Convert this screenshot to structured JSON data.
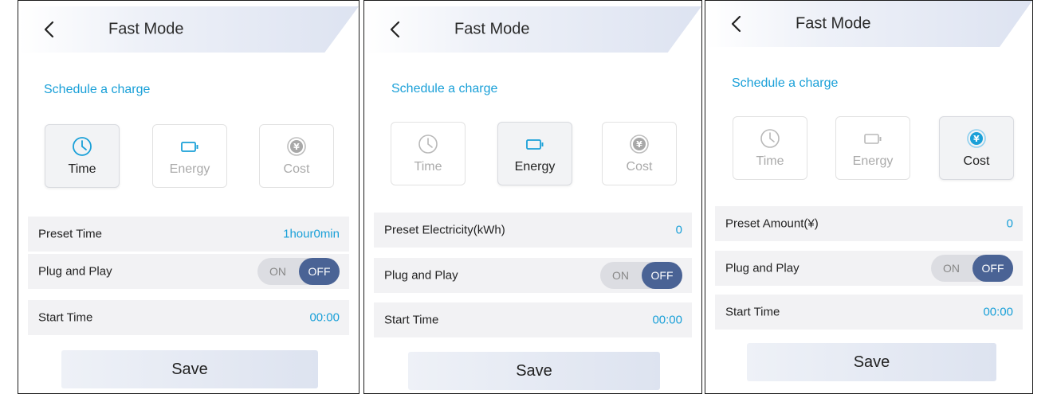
{
  "colors": {
    "accent": "#1aa0d8",
    "toggle_off_bg": "#4a6395",
    "icon_inactive": "#b8b8b8"
  },
  "screens": [
    {
      "header": {
        "back_icon": "chevron-left-icon",
        "title": "Fast Mode"
      },
      "section_title": "Schedule a charge",
      "modes": [
        {
          "label": "Time",
          "icon": "clock-icon",
          "active": true
        },
        {
          "label": "Energy",
          "icon": "battery-icon",
          "active": false
        },
        {
          "label": "Cost",
          "icon": "yen-coin-icon",
          "active": false
        }
      ],
      "preset": {
        "label": "Preset Time",
        "value": "1hour0min"
      },
      "plug_and_play": {
        "label": "Plug and Play",
        "on_label": "ON",
        "off_label": "OFF",
        "state": "OFF"
      },
      "start_time": {
        "label": "Start Time",
        "value": "00:00"
      },
      "save_label": "Save"
    },
    {
      "header": {
        "back_icon": "chevron-left-icon",
        "title": "Fast Mode"
      },
      "section_title": "Schedule a charge",
      "modes": [
        {
          "label": "Time",
          "icon": "clock-icon",
          "active": false
        },
        {
          "label": "Energy",
          "icon": "battery-icon",
          "active": true
        },
        {
          "label": "Cost",
          "icon": "yen-coin-icon",
          "active": false
        }
      ],
      "preset": {
        "label": "Preset Electricity(kWh)",
        "value": "0"
      },
      "plug_and_play": {
        "label": "Plug and Play",
        "on_label": "ON",
        "off_label": "OFF",
        "state": "OFF"
      },
      "start_time": {
        "label": "Start Time",
        "value": "00:00"
      },
      "save_label": "Save"
    },
    {
      "header": {
        "back_icon": "chevron-left-icon",
        "title": "Fast Mode"
      },
      "section_title": "Schedule a charge",
      "modes": [
        {
          "label": "Time",
          "icon": "clock-icon",
          "active": false
        },
        {
          "label": "Energy",
          "icon": "battery-icon",
          "active": false
        },
        {
          "label": "Cost",
          "icon": "yen-coin-icon",
          "active": true
        }
      ],
      "preset": {
        "label": "Preset Amount(¥)",
        "value": "0"
      },
      "plug_and_play": {
        "label": "Plug and Play",
        "on_label": "ON",
        "off_label": "OFF",
        "state": "OFF"
      },
      "start_time": {
        "label": "Start Time",
        "value": "00:00"
      },
      "save_label": "Save"
    }
  ]
}
